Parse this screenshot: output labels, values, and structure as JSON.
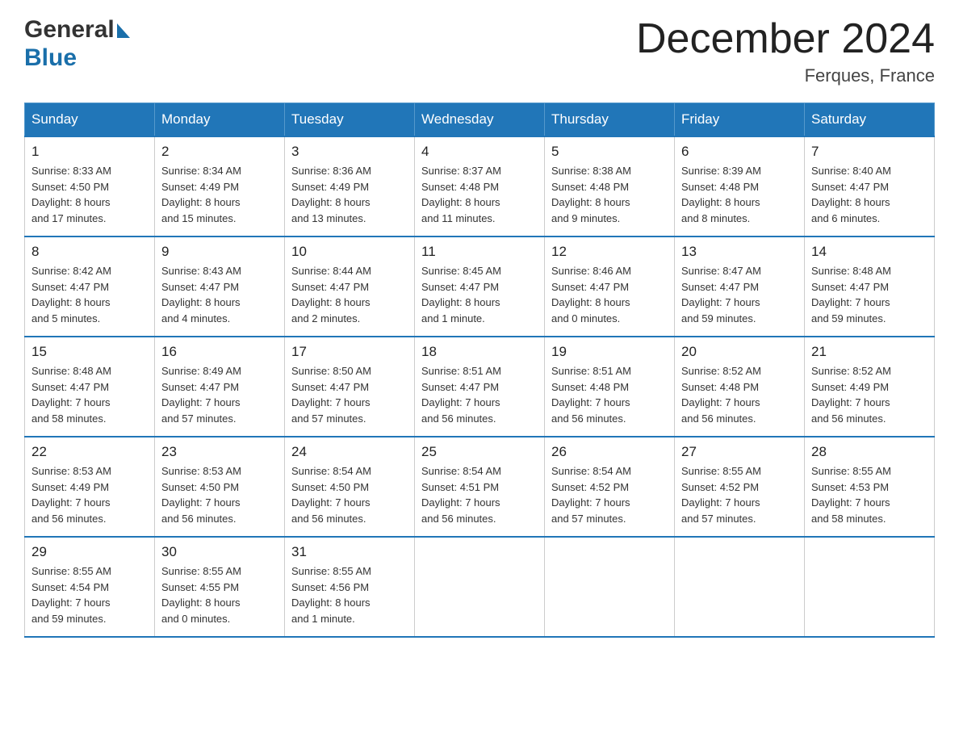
{
  "header": {
    "logo_general": "General",
    "logo_blue": "Blue",
    "month_title": "December 2024",
    "location": "Ferques, France"
  },
  "weekdays": [
    "Sunday",
    "Monday",
    "Tuesday",
    "Wednesday",
    "Thursday",
    "Friday",
    "Saturday"
  ],
  "weeks": [
    [
      {
        "day": "1",
        "sunrise": "8:33 AM",
        "sunset": "4:50 PM",
        "daylight": "8 hours and 17 minutes."
      },
      {
        "day": "2",
        "sunrise": "8:34 AM",
        "sunset": "4:49 PM",
        "daylight": "8 hours and 15 minutes."
      },
      {
        "day": "3",
        "sunrise": "8:36 AM",
        "sunset": "4:49 PM",
        "daylight": "8 hours and 13 minutes."
      },
      {
        "day": "4",
        "sunrise": "8:37 AM",
        "sunset": "4:48 PM",
        "daylight": "8 hours and 11 minutes."
      },
      {
        "day": "5",
        "sunrise": "8:38 AM",
        "sunset": "4:48 PM",
        "daylight": "8 hours and 9 minutes."
      },
      {
        "day": "6",
        "sunrise": "8:39 AM",
        "sunset": "4:48 PM",
        "daylight": "8 hours and 8 minutes."
      },
      {
        "day": "7",
        "sunrise": "8:40 AM",
        "sunset": "4:47 PM",
        "daylight": "8 hours and 6 minutes."
      }
    ],
    [
      {
        "day": "8",
        "sunrise": "8:42 AM",
        "sunset": "4:47 PM",
        "daylight": "8 hours and 5 minutes."
      },
      {
        "day": "9",
        "sunrise": "8:43 AM",
        "sunset": "4:47 PM",
        "daylight": "8 hours and 4 minutes."
      },
      {
        "day": "10",
        "sunrise": "8:44 AM",
        "sunset": "4:47 PM",
        "daylight": "8 hours and 2 minutes."
      },
      {
        "day": "11",
        "sunrise": "8:45 AM",
        "sunset": "4:47 PM",
        "daylight": "8 hours and 1 minute."
      },
      {
        "day": "12",
        "sunrise": "8:46 AM",
        "sunset": "4:47 PM",
        "daylight": "8 hours and 0 minutes."
      },
      {
        "day": "13",
        "sunrise": "8:47 AM",
        "sunset": "4:47 PM",
        "daylight": "7 hours and 59 minutes."
      },
      {
        "day": "14",
        "sunrise": "8:48 AM",
        "sunset": "4:47 PM",
        "daylight": "7 hours and 59 minutes."
      }
    ],
    [
      {
        "day": "15",
        "sunrise": "8:48 AM",
        "sunset": "4:47 PM",
        "daylight": "7 hours and 58 minutes."
      },
      {
        "day": "16",
        "sunrise": "8:49 AM",
        "sunset": "4:47 PM",
        "daylight": "7 hours and 57 minutes."
      },
      {
        "day": "17",
        "sunrise": "8:50 AM",
        "sunset": "4:47 PM",
        "daylight": "7 hours and 57 minutes."
      },
      {
        "day": "18",
        "sunrise": "8:51 AM",
        "sunset": "4:47 PM",
        "daylight": "7 hours and 56 minutes."
      },
      {
        "day": "19",
        "sunrise": "8:51 AM",
        "sunset": "4:48 PM",
        "daylight": "7 hours and 56 minutes."
      },
      {
        "day": "20",
        "sunrise": "8:52 AM",
        "sunset": "4:48 PM",
        "daylight": "7 hours and 56 minutes."
      },
      {
        "day": "21",
        "sunrise": "8:52 AM",
        "sunset": "4:49 PM",
        "daylight": "7 hours and 56 minutes."
      }
    ],
    [
      {
        "day": "22",
        "sunrise": "8:53 AM",
        "sunset": "4:49 PM",
        "daylight": "7 hours and 56 minutes."
      },
      {
        "day": "23",
        "sunrise": "8:53 AM",
        "sunset": "4:50 PM",
        "daylight": "7 hours and 56 minutes."
      },
      {
        "day": "24",
        "sunrise": "8:54 AM",
        "sunset": "4:50 PM",
        "daylight": "7 hours and 56 minutes."
      },
      {
        "day": "25",
        "sunrise": "8:54 AM",
        "sunset": "4:51 PM",
        "daylight": "7 hours and 56 minutes."
      },
      {
        "day": "26",
        "sunrise": "8:54 AM",
        "sunset": "4:52 PM",
        "daylight": "7 hours and 57 minutes."
      },
      {
        "day": "27",
        "sunrise": "8:55 AM",
        "sunset": "4:52 PM",
        "daylight": "7 hours and 57 minutes."
      },
      {
        "day": "28",
        "sunrise": "8:55 AM",
        "sunset": "4:53 PM",
        "daylight": "7 hours and 58 minutes."
      }
    ],
    [
      {
        "day": "29",
        "sunrise": "8:55 AM",
        "sunset": "4:54 PM",
        "daylight": "7 hours and 59 minutes."
      },
      {
        "day": "30",
        "sunrise": "8:55 AM",
        "sunset": "4:55 PM",
        "daylight": "8 hours and 0 minutes."
      },
      {
        "day": "31",
        "sunrise": "8:55 AM",
        "sunset": "4:56 PM",
        "daylight": "8 hours and 1 minute."
      },
      null,
      null,
      null,
      null
    ]
  ],
  "labels": {
    "sunrise": "Sunrise:",
    "sunset": "Sunset:",
    "daylight": "Daylight:"
  }
}
